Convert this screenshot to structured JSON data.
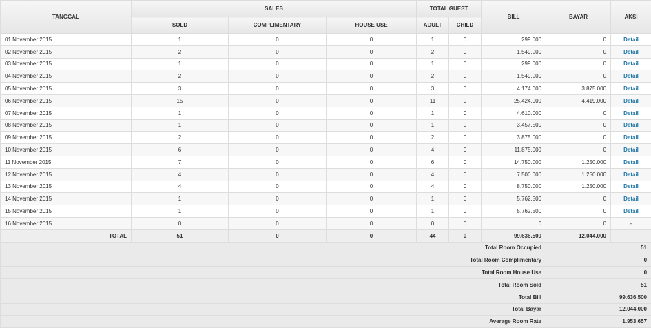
{
  "headers": {
    "tanggal": "TANGGAL",
    "sales": "SALES",
    "total_guest": "TOTAL GUEST",
    "bill": "BILL",
    "bayar": "BAYAR",
    "aksi": "AKSI",
    "sold": "SOLD",
    "complimentary": "COMPLIMENTARY",
    "house_use": "HOUSE USE",
    "adult": "ADULT",
    "child": "CHILD"
  },
  "rows": [
    {
      "date": "01 November 2015",
      "sold": "1",
      "comp": "0",
      "house": "0",
      "adult": "1",
      "child": "0",
      "bill": "299.000",
      "bayar": "0",
      "aksi": "Detail"
    },
    {
      "date": "02 November 2015",
      "sold": "2",
      "comp": "0",
      "house": "0",
      "adult": "2",
      "child": "0",
      "bill": "1.549.000",
      "bayar": "0",
      "aksi": "Detail"
    },
    {
      "date": "03 November 2015",
      "sold": "1",
      "comp": "0",
      "house": "0",
      "adult": "1",
      "child": "0",
      "bill": "299.000",
      "bayar": "0",
      "aksi": "Detail"
    },
    {
      "date": "04 November 2015",
      "sold": "2",
      "comp": "0",
      "house": "0",
      "adult": "2",
      "child": "0",
      "bill": "1.549.000",
      "bayar": "0",
      "aksi": "Detail"
    },
    {
      "date": "05 November 2015",
      "sold": "3",
      "comp": "0",
      "house": "0",
      "adult": "3",
      "child": "0",
      "bill": "4.174.000",
      "bayar": "3.875.000",
      "aksi": "Detail"
    },
    {
      "date": "06 November 2015",
      "sold": "15",
      "comp": "0",
      "house": "0",
      "adult": "11",
      "child": "0",
      "bill": "25.424.000",
      "bayar": "4.419.000",
      "aksi": "Detail"
    },
    {
      "date": "07 November 2015",
      "sold": "1",
      "comp": "0",
      "house": "0",
      "adult": "1",
      "child": "0",
      "bill": "4.610.000",
      "bayar": "0",
      "aksi": "Detail"
    },
    {
      "date": "08 November 2015",
      "sold": "1",
      "comp": "0",
      "house": "0",
      "adult": "1",
      "child": "0",
      "bill": "3.457.500",
      "bayar": "0",
      "aksi": "Detail"
    },
    {
      "date": "09 November 2015",
      "sold": "2",
      "comp": "0",
      "house": "0",
      "adult": "2",
      "child": "0",
      "bill": "3.875.000",
      "bayar": "0",
      "aksi": "Detail"
    },
    {
      "date": "10 November 2015",
      "sold": "6",
      "comp": "0",
      "house": "0",
      "adult": "4",
      "child": "0",
      "bill": "11.875.000",
      "bayar": "0",
      "aksi": "Detail"
    },
    {
      "date": "11 November 2015",
      "sold": "7",
      "comp": "0",
      "house": "0",
      "adult": "6",
      "child": "0",
      "bill": "14.750.000",
      "bayar": "1.250.000",
      "aksi": "Detail"
    },
    {
      "date": "12 November 2015",
      "sold": "4",
      "comp": "0",
      "house": "0",
      "adult": "4",
      "child": "0",
      "bill": "7.500.000",
      "bayar": "1.250.000",
      "aksi": "Detail"
    },
    {
      "date": "13 November 2015",
      "sold": "4",
      "comp": "0",
      "house": "0",
      "adult": "4",
      "child": "0",
      "bill": "8.750.000",
      "bayar": "1.250.000",
      "aksi": "Detail"
    },
    {
      "date": "14 November 2015",
      "sold": "1",
      "comp": "0",
      "house": "0",
      "adult": "1",
      "child": "0",
      "bill": "5.762.500",
      "bayar": "0",
      "aksi": "Detail"
    },
    {
      "date": "15 November 2015",
      "sold": "1",
      "comp": "0",
      "house": "0",
      "adult": "1",
      "child": "0",
      "bill": "5.762.500",
      "bayar": "0",
      "aksi": "Detail"
    },
    {
      "date": "16 November 2015",
      "sold": "0",
      "comp": "0",
      "house": "0",
      "adult": "0",
      "child": "0",
      "bill": "0",
      "bayar": "0",
      "aksi": "-"
    }
  ],
  "total": {
    "label": "TOTAL",
    "sold": "51",
    "comp": "0",
    "house": "0",
    "adult": "44",
    "child": "0",
    "bill": "99.636.500",
    "bayar": "12.044.000"
  },
  "summary": [
    {
      "label": "Total Room Occupied",
      "value": "51"
    },
    {
      "label": "Total Room Complimentary",
      "value": "0"
    },
    {
      "label": "Total Room House Use",
      "value": "0"
    },
    {
      "label": "Total Room Sold",
      "value": "51"
    },
    {
      "label": "Total Bill",
      "value": "99.636.500"
    },
    {
      "label": "Total Bayar",
      "value": "12.044.000"
    },
    {
      "label": "Average Room Rate",
      "value": "1.953.657"
    }
  ],
  "colors": {
    "link": "#1f77a8",
    "border": "#dddddd",
    "header_bg": "#e6e6e6"
  }
}
